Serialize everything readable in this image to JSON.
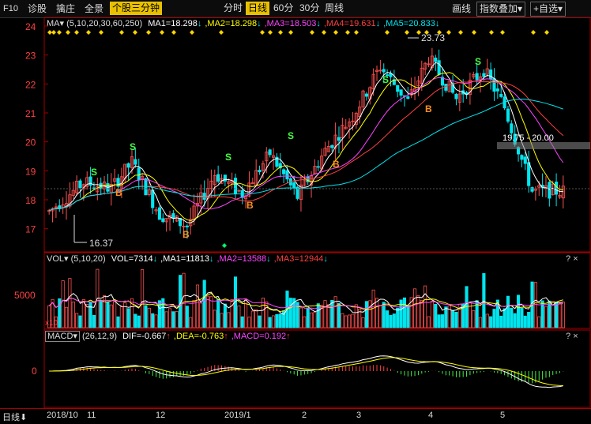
{
  "toolbar": {
    "code": "F10",
    "left_tabs": [
      "诊股",
      "擒庄",
      "全景"
    ],
    "active_tab": "个股三分钟",
    "periods": [
      "分时",
      "日线",
      "60分",
      "30分",
      "周线"
    ],
    "active_period": "日线",
    "draw_label": "画线",
    "overlay_label": "指数叠加",
    "watch_label": "+自选"
  },
  "kline": {
    "indicator": "MA",
    "params": "(5,10,20,30,60,250)",
    "values": [
      {
        "label": "MA1=18.298",
        "color": "#ffffff"
      },
      {
        "label": "MA2=18.298",
        "color": "#ffff00"
      },
      {
        "label": "MA3=18.503",
        "color": "#ff44ff"
      },
      {
        "label": "MA4=19.631",
        "color": "#ff4040"
      },
      {
        "label": "MA5=20.833",
        "color": "#00e5ee"
      }
    ],
    "y_ticks": [
      "24",
      "23",
      "22",
      "21",
      "20",
      "19",
      "18",
      "17"
    ],
    "high_label": "23.73",
    "low_label": "16.37",
    "range_label": "19.75 - 20.00",
    "buy_mark": "B",
    "sell_mark": "S"
  },
  "volume": {
    "indicator": "VOL",
    "params": "(5,10,20)",
    "values": [
      {
        "label": "VOL=7314",
        "color": "#ffffff"
      },
      {
        "label": "MA1=11813",
        "color": "#ffffff"
      },
      {
        "label": "MA2=13588",
        "color": "#ff44ff"
      },
      {
        "label": "MA3=12944",
        "color": "#ff4040"
      }
    ],
    "y_tick": "5000",
    "unit": "x10"
  },
  "macd": {
    "indicator": "MACD",
    "params": "(26,12,9)",
    "values": [
      {
        "label": "DIF=-0.667",
        "color": "#ffffff"
      },
      {
        "label": "DEA=-0.763",
        "color": "#ffff00"
      },
      {
        "label": "MACD=0.192",
        "color": "#ff44ff"
      }
    ],
    "y_tick": "0"
  },
  "footer": {
    "mode": "日线",
    "dates": [
      "2018/10",
      "11",
      "12",
      "2019/1",
      "2",
      "3",
      "4",
      "5"
    ]
  },
  "panel_buttons": [
    "?",
    "×"
  ],
  "chart_data": {
    "type": "candlestick",
    "y_range": [
      16.2,
      24.3
    ],
    "high": 23.73,
    "low": 16.37,
    "ma_values": {
      "MA1": 18.298,
      "MA2": 18.298,
      "MA3": 18.503,
      "MA4": 19.631,
      "MA5": 20.833
    },
    "volume": {
      "VOL": 7314,
      "MA1": 11813,
      "MA2": 13588,
      "MA3": 12944
    },
    "macd": {
      "DIF": -0.667,
      "DEA": -0.763,
      "MACD": 0.192
    }
  }
}
